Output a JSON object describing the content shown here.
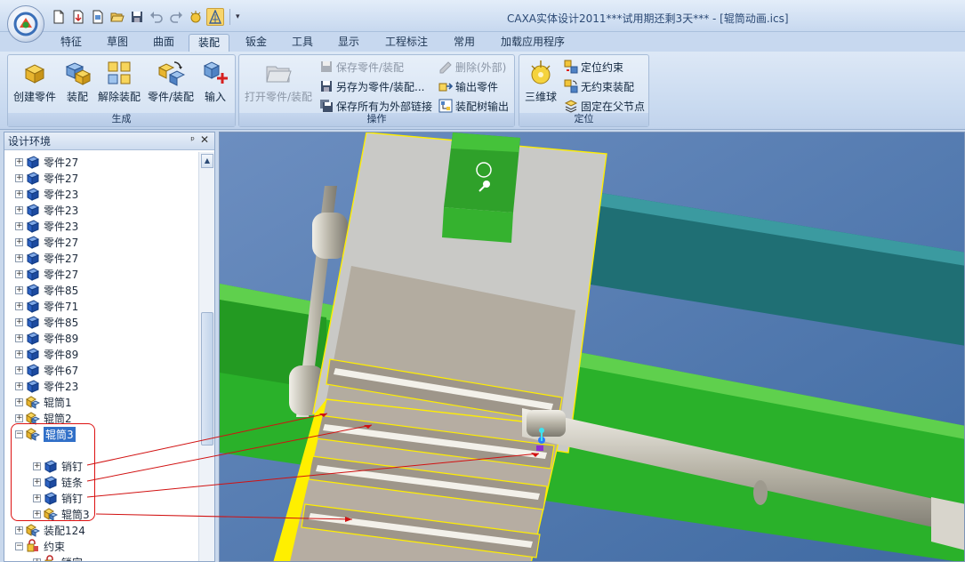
{
  "window": {
    "title": "CAXA实体设计2011***试用期还剩3天*** - [辊筒动画.ics]"
  },
  "icons": {
    "app_button": "caxa-logo-icon",
    "quick_access": [
      "new-file-icon",
      "import-file-icon",
      "document-icon",
      "open-folder-icon",
      "save-icon",
      "undo-icon",
      "redo-icon",
      "smart-tool-icon",
      "triball-tool-icon"
    ],
    "tree_part": "part-icon",
    "tree_assembly": "assembly-icon",
    "tree_constraint": "constraint-icon"
  },
  "tabs": [
    {
      "label": "特征",
      "active": false
    },
    {
      "label": "草图",
      "active": false
    },
    {
      "label": "曲面",
      "active": false
    },
    {
      "label": "装配",
      "active": true
    },
    {
      "label": "钣金",
      "active": false
    },
    {
      "label": "工具",
      "active": false
    },
    {
      "label": "显示",
      "active": false
    },
    {
      "label": "工程标注",
      "active": false
    },
    {
      "label": "常用",
      "active": false
    },
    {
      "label": "加载应用程序",
      "active": false
    }
  ],
  "ribbon": {
    "generate": {
      "label": "生成",
      "buttons": [
        "创建零件",
        "装配",
        "解除装配",
        "零件/装配",
        "输入"
      ]
    },
    "operate": {
      "label": "操作",
      "open_button": "打开零件/装配",
      "small": [
        "保存零件/装配",
        "另存为零件/装配...",
        "保存所有为外部链接",
        "删除(外部)",
        "输出零件",
        "装配树输出"
      ]
    },
    "position": {
      "label": "定位",
      "big_button": "三维球",
      "small": [
        "定位约束",
        "无约束装配",
        "固定在父节点"
      ]
    }
  },
  "panel": {
    "title": "设计环境",
    "pin": "ᵖ",
    "close": "✕"
  },
  "tree": {
    "rows": [
      {
        "label": "零件27",
        "icon": "part",
        "level": 0,
        "expander": "+"
      },
      {
        "label": "零件27",
        "icon": "part",
        "level": 0,
        "expander": "+"
      },
      {
        "label": "零件23",
        "icon": "part",
        "level": 0,
        "expander": "+"
      },
      {
        "label": "零件23",
        "icon": "part",
        "level": 0,
        "expander": "+"
      },
      {
        "label": "零件23",
        "icon": "part",
        "level": 0,
        "expander": "+"
      },
      {
        "label": "零件27",
        "icon": "part",
        "level": 0,
        "expander": "+"
      },
      {
        "label": "零件27",
        "icon": "part",
        "level": 0,
        "expander": "+"
      },
      {
        "label": "零件27",
        "icon": "part",
        "level": 0,
        "expander": "+"
      },
      {
        "label": "零件85",
        "icon": "part",
        "level": 0,
        "expander": "+"
      },
      {
        "label": "零件71",
        "icon": "part",
        "level": 0,
        "expander": "+"
      },
      {
        "label": "零件85",
        "icon": "part",
        "level": 0,
        "expander": "+"
      },
      {
        "label": "零件89",
        "icon": "part",
        "level": 0,
        "expander": "+"
      },
      {
        "label": "零件89",
        "icon": "part",
        "level": 0,
        "expander": "+"
      },
      {
        "label": "零件67",
        "icon": "part",
        "level": 0,
        "expander": "+"
      },
      {
        "label": "零件23",
        "icon": "part",
        "level": 0,
        "expander": "+"
      },
      {
        "label": "辊筒1",
        "icon": "assembly",
        "level": 0,
        "expander": "+"
      },
      {
        "label": "辊筒2",
        "icon": "assembly",
        "level": 0,
        "expander": "+"
      },
      {
        "label": "辊筒3",
        "icon": "assembly",
        "level": 0,
        "expander": "-",
        "selected": true
      },
      {
        "label": "",
        "icon": "none",
        "level": 1,
        "expander": ""
      },
      {
        "label": "销钉",
        "icon": "part",
        "level": 1,
        "expander": "+"
      },
      {
        "label": "链条",
        "icon": "part",
        "level": 1,
        "expander": "+"
      },
      {
        "label": "销钉",
        "icon": "part",
        "level": 1,
        "expander": "+"
      },
      {
        "label": "辊筒3",
        "icon": "assembly",
        "level": 1,
        "expander": "+"
      },
      {
        "label": "装配124",
        "icon": "assembly",
        "level": 0,
        "expander": "+"
      },
      {
        "label": "约束",
        "icon": "constraint",
        "level": 0,
        "expander": "-"
      },
      {
        "label": "锁定",
        "icon": "constraint",
        "level": 1,
        "expander": "+"
      }
    ]
  },
  "colors": {
    "ribbon_bg": "#d3e1f2",
    "viewport_bg": "#4c74a8",
    "green_rail": "#2bb024",
    "teal_rail": "#1e6d72",
    "selection_yellow": "#ffef00",
    "annotation_red": "#d11111",
    "tree_selection": "#3170c8"
  }
}
